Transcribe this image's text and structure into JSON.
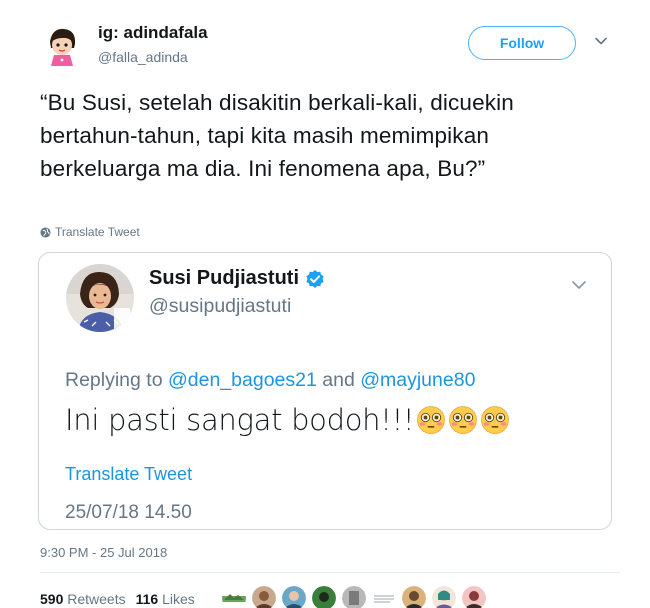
{
  "tweet": {
    "display_name": "ig: adindafala",
    "handle": "@falla_adinda",
    "follow_label": "Follow",
    "text": "“Bu Susi, setelah disakitin berkali-kali, dicuekin bertahun-tahun, tapi kita masih memimpikan berkeluarga ma dia. Ini fenomena apa, Bu?”",
    "translate_label": "Translate Tweet",
    "timestamp": "9:30 PM - 25 Jul 2018",
    "retweets_count": "590",
    "retweets_label": "Retweets",
    "likes_count": "116",
    "likes_label": "Likes"
  },
  "quoted_tweet": {
    "display_name": "Susi Pudjiastuti",
    "handle": "@susipudjiastuti",
    "replying_prefix": "Replying to",
    "mention_1": "@den_bagoes21",
    "replying_and": "and",
    "mention_2": "@mayjune80",
    "text": "Ini pasti sangat bodoh!!!",
    "emoji_name": "flushed-face-emoji",
    "translate_label": "Translate Tweet",
    "date": "25/07/18 14.50"
  },
  "colors": {
    "accent": "#1da1f2",
    "secondary_text": "#657786",
    "border": "#ccd6dd",
    "verified": "#1da1f2"
  },
  "icons": {
    "caret": "chevron-down-icon",
    "globe": "globe-icon",
    "verified": "verified-badge-icon"
  }
}
